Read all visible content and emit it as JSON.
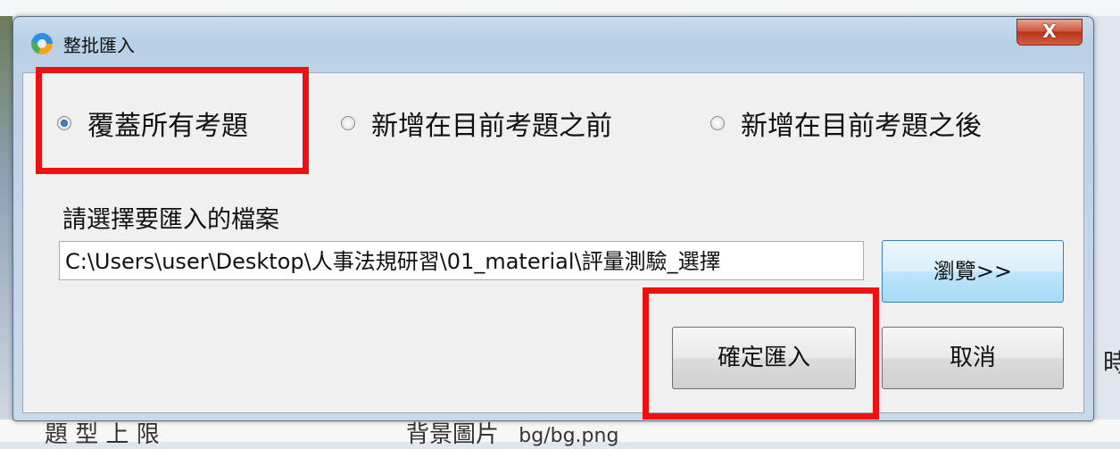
{
  "window": {
    "title": "整批匯入",
    "close_label": "X"
  },
  "import_mode": {
    "options": [
      {
        "label": "覆蓋所有考題",
        "selected": true
      },
      {
        "label": "新增在目前考題之前",
        "selected": false
      },
      {
        "label": "新增在目前考題之後",
        "selected": false
      }
    ]
  },
  "file": {
    "label": "請選擇要匯入的檔案",
    "path": "C:\\Users\\user\\Desktop\\人事法規研習\\01_material\\評量測驗_選擇",
    "browse_label": "瀏覽>>"
  },
  "actions": {
    "ok_label": "確定匯入",
    "cancel_label": "取消"
  },
  "background": {
    "bottom_left_text": "題 型 上 限",
    "bottom_mid_label": "背景圖片",
    "bottom_mid_value": "bg/bg.png",
    "right_edge_char": "時"
  },
  "colors": {
    "highlight": "#ee1111",
    "close_button": "#c84a2c"
  }
}
